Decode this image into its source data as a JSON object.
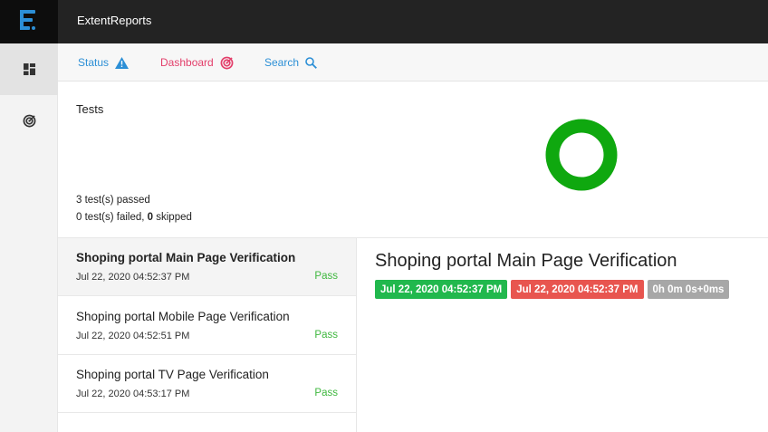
{
  "app": {
    "title": "ExtentReports"
  },
  "tabs": {
    "status": "Status",
    "dashboard": "Dashboard",
    "search": "Search"
  },
  "summary": {
    "title": "Tests",
    "passed_text": "3 test(s) passed",
    "failed_count": "0",
    "failed_label": "test(s) failed,",
    "skipped_count": "0",
    "skipped_label": "skipped",
    "pass_ratio": 1.0
  },
  "tests": [
    {
      "name": "Shoping portal Main Page Verification",
      "time": "Jul 22, 2020 04:52:37 PM",
      "status": "Pass"
    },
    {
      "name": "Shoping portal Mobile Page Verification",
      "time": "Jul 22, 2020 04:52:51 PM",
      "status": "Pass"
    },
    {
      "name": "Shoping portal TV Page Verification",
      "time": "Jul 22, 2020 04:53:17 PM",
      "status": "Pass"
    }
  ],
  "detail": {
    "title": "Shoping portal Main Page Verification",
    "start_time": "Jul 22, 2020 04:52:37 PM",
    "end_time": "Jul 22, 2020 04:52:37 PM",
    "duration": "0h 0m 0s+0ms"
  },
  "colors": {
    "pass": "#0fa80f",
    "accent_blue": "#2c8fd6",
    "accent_pink": "#e33e6a",
    "header": "#232323"
  },
  "icons": {
    "logo": "extent-logo-icon",
    "dashboard_nav": "dashboard-grid-icon",
    "analytics_nav": "target-icon",
    "status_tab": "warning-triangle-icon",
    "dashboard_tab": "target-icon",
    "search_tab": "search-icon"
  }
}
